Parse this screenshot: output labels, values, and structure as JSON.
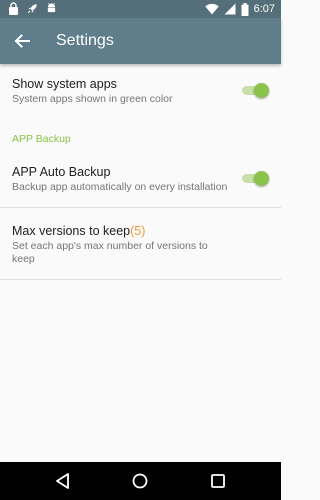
{
  "status_bar": {
    "time": "6:07",
    "left_icons": [
      "lock-icon",
      "rocket-icon",
      "android-icon"
    ],
    "right_icons": [
      "wifi-icon",
      "signal-icon",
      "battery-icon"
    ]
  },
  "toolbar": {
    "title": "Settings",
    "back_icon": "arrow-back-icon"
  },
  "preferences": {
    "show_system_apps": {
      "title": "Show system apps",
      "summary": "System apps shown in green color",
      "enabled": true
    },
    "category_backup": "APP Backup",
    "auto_backup": {
      "title": "APP Auto Backup",
      "summary": "Backup app automatically on every installation",
      "enabled": true
    },
    "max_versions": {
      "title": "Max versions to keep",
      "value": "(5)",
      "summary": "Set each app's max number of versions to keep"
    }
  },
  "nav_bar": {
    "buttons": [
      "back-triangle-icon",
      "home-circle-icon",
      "recents-square-icon"
    ]
  },
  "colors": {
    "status_bar": "#546e7a",
    "toolbar": "#607d8b",
    "accent_green": "#8bc34a",
    "value_orange": "#ef9a3a",
    "background": "#fafafa"
  }
}
